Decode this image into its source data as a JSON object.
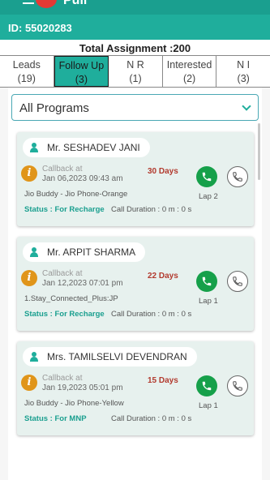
{
  "header": {
    "brand": "Jio",
    "app_name": "Pull",
    "id_label": "ID: 55020283",
    "colors": {
      "primary": "#1fae9c",
      "dark": "#1a9f8f",
      "logo": "#e53935"
    }
  },
  "summary": {
    "total_assignment": "Total Assignment :200"
  },
  "tabs": [
    {
      "label": "Leads",
      "count": "(19)",
      "active": false
    },
    {
      "label": "Follow Up",
      "count": "(3)",
      "active": true
    },
    {
      "label": "N R",
      "count": "(1)",
      "active": false
    },
    {
      "label": "Interested",
      "count": "(2)",
      "active": false
    },
    {
      "label": "N I",
      "count": "(3)",
      "active": false
    }
  ],
  "filter": {
    "selected": "All Programs"
  },
  "cards": [
    {
      "name": "Mr. SESHADEV JANI",
      "callback_label": "Callback at",
      "callback_date": "Jan 06,2023 09:43 am",
      "days": "30 Days",
      "program": "Jio Buddy - Jio Phone-Orange",
      "lap": "Lap 2",
      "status_label": "Status : For Recharge",
      "duration": "Call Duration : 0 m : 0 s"
    },
    {
      "name": "Mr. ARPIT SHARMA",
      "callback_label": "Callback at",
      "callback_date": "Jan 12,2023 07:01 pm",
      "days": "22 Days",
      "program": "1.Stay_Connected_Plus:JP",
      "lap": "Lap 1",
      "status_label": "Status : For Recharge",
      "duration": "Call Duration : 0 m : 0 s"
    },
    {
      "name": "Mrs. TAMILSELVI DEVENDRAN",
      "callback_label": "Callback at",
      "callback_date": "Jan 19,2023 05:01 pm",
      "days": "15 Days",
      "program": "Jio Buddy - Jio Phone-Yellow",
      "lap": "Lap 1",
      "status_label": "Status : For MNP",
      "duration": "Call Duration : 0 m : 0 s"
    }
  ],
  "icons": [
    "menu-icon",
    "person-icon",
    "info-icon",
    "phone-icon",
    "chevron-down-icon"
  ]
}
